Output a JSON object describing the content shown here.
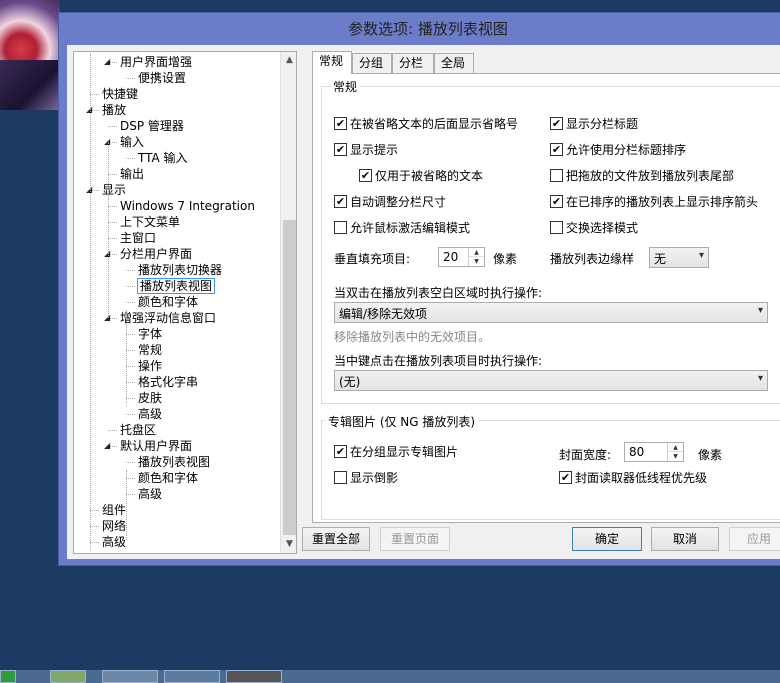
{
  "window": {
    "title": "参数选项: 播放列表视图"
  },
  "tree": {
    "items": [
      {
        "label": "用户界面增强",
        "level": 1,
        "arrow": "◢"
      },
      {
        "label": "便携设置",
        "level": 2
      },
      {
        "label": "快捷键",
        "level": 0
      },
      {
        "label": "播放",
        "level": 0,
        "arrow": "◢"
      },
      {
        "label": "DSP 管理器",
        "level": 1
      },
      {
        "label": "输入",
        "level": 1,
        "arrow": "◢"
      },
      {
        "label": "TTA 输入",
        "level": 2
      },
      {
        "label": "输出",
        "level": 1
      },
      {
        "label": "显示",
        "level": 0,
        "arrow": "◢"
      },
      {
        "label": "Windows 7 Integration",
        "level": 1
      },
      {
        "label": "上下文菜单",
        "level": 1
      },
      {
        "label": "主窗口",
        "level": 1
      },
      {
        "label": "分栏用户界面",
        "level": 1,
        "arrow": "◢"
      },
      {
        "label": "播放列表切换器",
        "level": 2
      },
      {
        "label": "播放列表视图",
        "level": 2,
        "selected": true
      },
      {
        "label": "颜色和字体",
        "level": 2
      },
      {
        "label": "增强浮动信息窗口",
        "level": 1,
        "arrow": "◢"
      },
      {
        "label": "字体",
        "level": 2
      },
      {
        "label": "常规",
        "level": 2
      },
      {
        "label": "操作",
        "level": 2
      },
      {
        "label": "格式化字串",
        "level": 2
      },
      {
        "label": "皮肤",
        "level": 2
      },
      {
        "label": "高级",
        "level": 2
      },
      {
        "label": "托盘区",
        "level": 1
      },
      {
        "label": "默认用户界面",
        "level": 1,
        "arrow": "◢"
      },
      {
        "label": "播放列表视图",
        "level": 2
      },
      {
        "label": "颜色和字体",
        "level": 2
      },
      {
        "label": "高级",
        "level": 2
      },
      {
        "label": "组件",
        "level": 0
      },
      {
        "label": "网络",
        "level": 0
      },
      {
        "label": "高级",
        "level": 0
      }
    ]
  },
  "tabs": [
    {
      "label": "常规",
      "active": true
    },
    {
      "label": "分组"
    },
    {
      "label": "分栏"
    },
    {
      "label": "全局"
    }
  ],
  "general": {
    "title": "常规",
    "checkboxes_left": [
      {
        "label": "在被省略文本的后面显示省略号",
        "checked": true
      },
      {
        "label": "显示提示",
        "checked": true
      },
      {
        "label": "仅用于被省略的文本",
        "checked": true
      },
      {
        "label": "自动调整分栏尺寸",
        "checked": true
      },
      {
        "label": "允许鼠标激活编辑模式",
        "checked": false
      }
    ],
    "checkboxes_right": [
      {
        "label": "显示分栏标题",
        "checked": true
      },
      {
        "label": "允许使用分栏标题排序",
        "checked": true
      },
      {
        "label": "把拖放的文件放到播放列表尾部",
        "checked": false
      },
      {
        "label": "在已排序的播放列表上显示排序箭头",
        "checked": true
      },
      {
        "label": "交换选择模式",
        "checked": false
      }
    ],
    "vpad_label": "垂直填充项目:",
    "vpad_value": "20",
    "vpad_unit": "像素",
    "edge_label": "播放列表边缘样",
    "edge_value": "无",
    "dblclick_label": "当双击在播放列表空白区域时执行操作:",
    "dblclick_value": "编辑/移除无效项",
    "dblclick_hint": "移除播放列表中的无效项目。",
    "midclick_label": "当中键点击在播放列表项目时执行操作:",
    "midclick_value": "(无)"
  },
  "artwork": {
    "title": "专辑图片 (仅 NG 播放列表)",
    "show_in_group": {
      "label": "在分组显示专辑图片",
      "checked": true
    },
    "show_reflection": {
      "label": "显示倒影",
      "checked": false
    },
    "width_label": "封面宽度:",
    "width_value": "80",
    "width_unit": "像素",
    "low_priority": {
      "label": "封面读取器低线程优先级",
      "checked": true
    }
  },
  "buttons": {
    "reset_all": "重置全部",
    "reset_page": "重置页面",
    "ok": "确定",
    "cancel": "取消",
    "apply": "应用"
  },
  "colors": {
    "title_bar": "#6b7cc8",
    "desktop": "#1d3a63",
    "selection": "#3399ff"
  }
}
